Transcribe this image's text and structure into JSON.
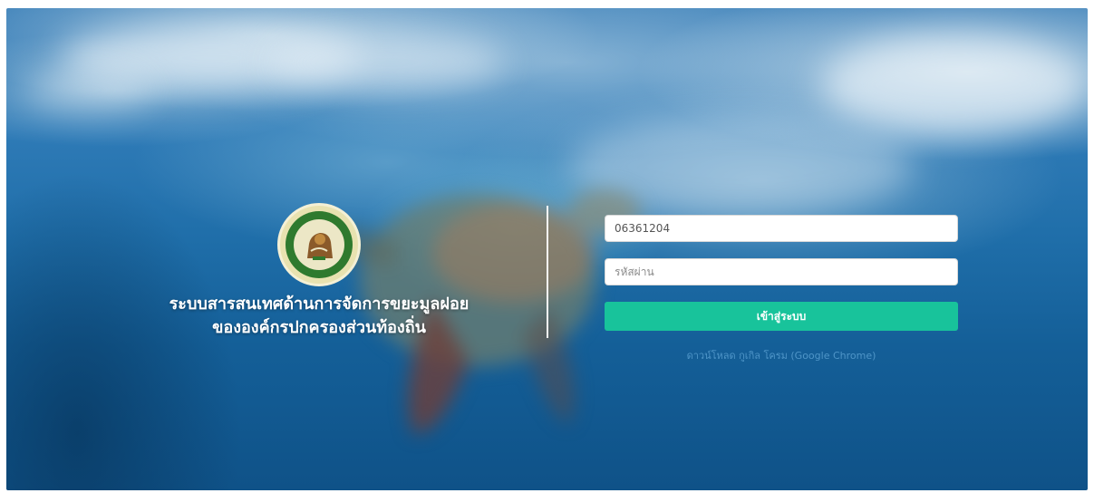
{
  "branding": {
    "logo_icon": "department-seal-logo",
    "title_line1": "ระบบสารสนเทศด้านการจัดการขยะมูลฝอย",
    "title_line2": "ขององค์กรปกครองส่วนท้องถิ่น"
  },
  "login": {
    "username_value": "06361204",
    "password_placeholder": "รหัสผ่าน",
    "submit_label": "เข้าสู่ระบบ",
    "download_link": "ดาวน์โหลด กูเกิล โครม (Google Chrome)"
  },
  "colors": {
    "accent": "#18c39b",
    "link": "#4f95c8",
    "background_ocean": "#1f6ea9"
  }
}
